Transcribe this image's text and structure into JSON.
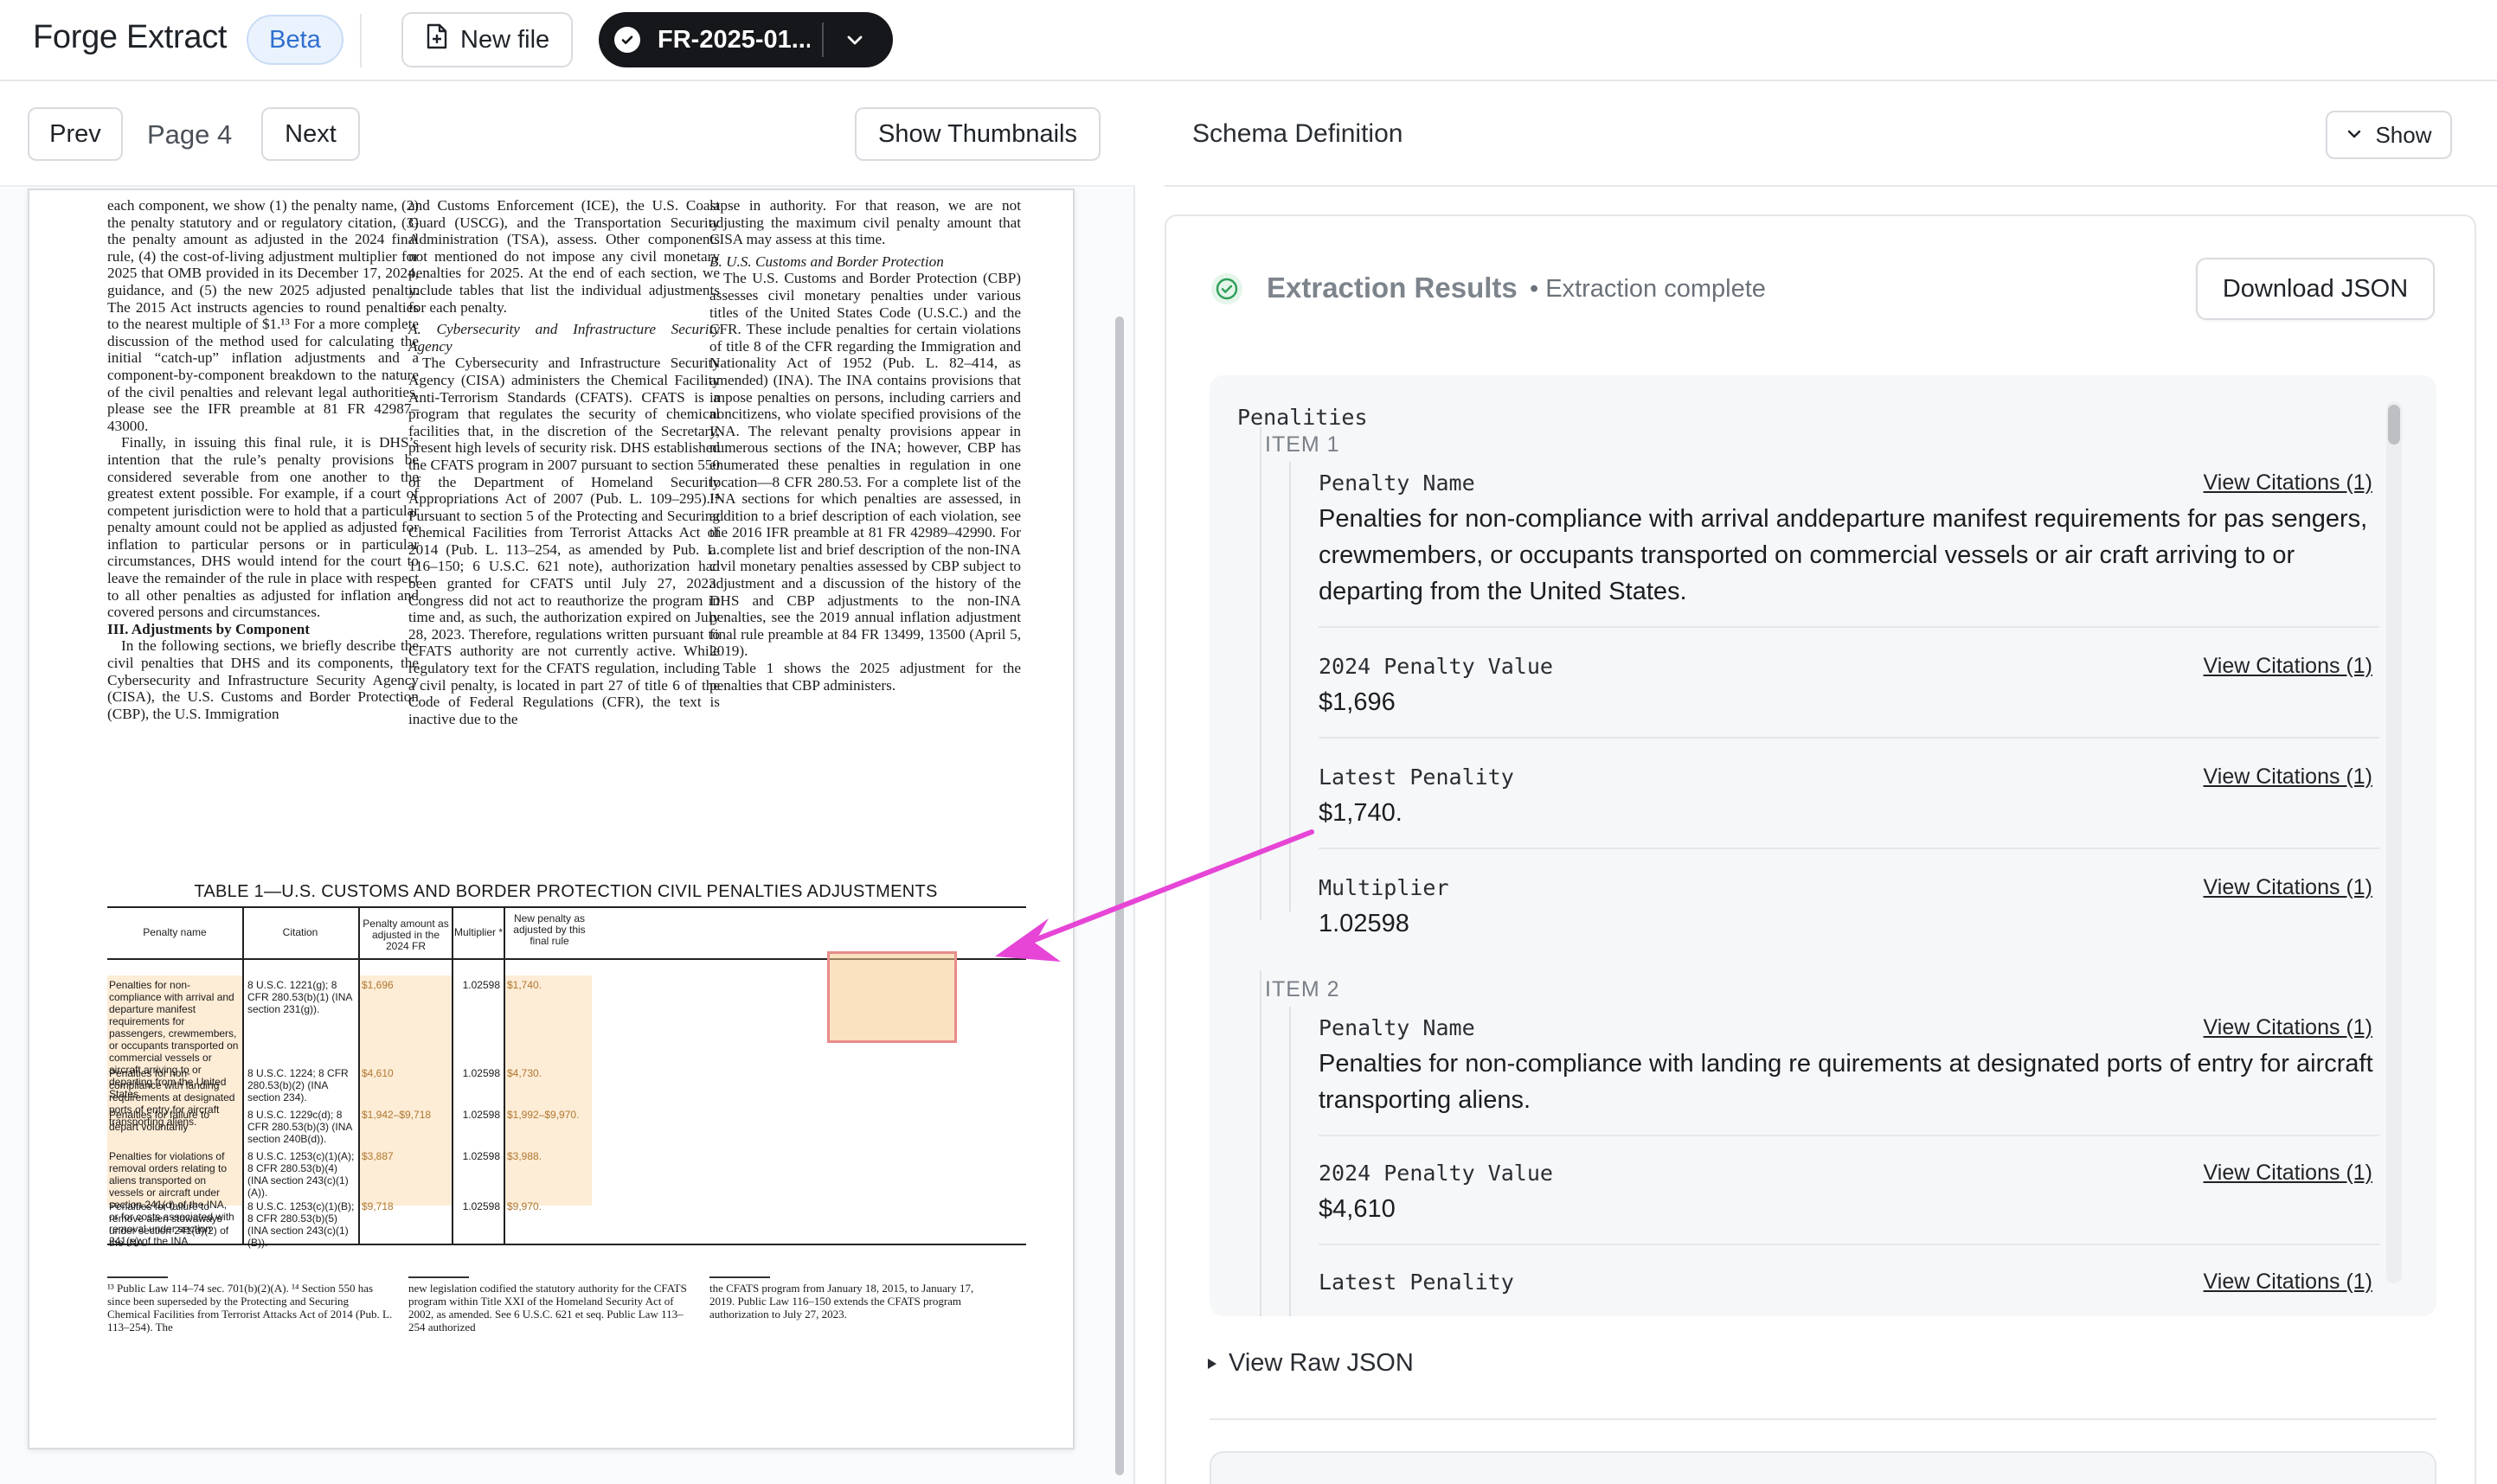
{
  "topbar": {
    "brand": "Forge Extract",
    "badge": "Beta",
    "new_file": "New file",
    "document": "FR-2025-01..."
  },
  "pager": {
    "prev": "Prev",
    "page": "Page 4",
    "next": "Next",
    "thumbnails": "Show Thumbnails"
  },
  "document": {
    "col1": [
      "each component, we show (1) the penalty name, (2) the penalty statutory and or regulatory citation, (3) the penalty amount as adjusted in the 2024 final rule, (4) the cost-of-living adjustment multiplier for 2025 that OMB provided in its December 17, 2024, guidance, and (5) the new 2025 adjusted penalty. The 2015 Act instructs agencies to round penalties to the nearest multiple of $1.¹³ For a more complete discussion of the method used for calculating the initial “catch-up” inflation adjustments and a component-by-component breakdown to the nature of the civil penalties and relevant legal authorities, please see the IFR preamble at 81 FR 42987–43000.",
      "Finally, in issuing this final rule, it is DHS’s intention that the rule’s penalty provisions be considered severable from one another to the greatest extent possible. For example, if a court of competent jurisdiction were to hold that a particular penalty amount could not be applied as adjusted for inflation to particular persons or in particular circumstances, DHS would intend for the court to leave the remainder of the rule in place with respect to all other penalties as adjusted for inflation and covered persons and circumstances.",
      "III. Adjustments by Component",
      "In the following sections, we briefly describe the civil penalties that DHS and its components, the Cybersecurity and Infrastructure Security Agency (CISA), the U.S. Customs and Border Protection (CBP), the U.S. Immigration"
    ],
    "col2": [
      "and Customs Enforcement (ICE), the U.S. Coast Guard (USCG), and the Transportation Security Administration (TSA), assess. Other components not mentioned do not impose any civil monetary penalties for 2025. At the end of each section, we include tables that list the individual adjustments for each penalty.",
      "A. Cybersecurity and Infrastructure Security Agency",
      "The Cybersecurity and Infrastructure Security Agency (CISA) administers the Chemical Facility Anti-Terrorism Standards (CFATS). CFATS is a program that regulates the security of chemical facilities that, in the discretion of the Secretary, present high levels of security risk. DHS established the CFATS program in 2007 pursuant to section 550 of the Department of Homeland Security Appropriations Act of 2007 (Pub. L. 109–295).¹⁴ Pursuant to section 5 of the Protecting and Securing Chemical Facilities from Terrorist Attacks Act of 2014 (Pub. L. 113–254, as amended by Pub. L. 116–150; 6 U.S.C. 621 note), authorization had been granted for CFATS until July 27, 2023. Congress did not act to reauthorize the program in time and, as such, the authorization expired on July 28, 2023. Therefore, regulations written pursuant to CFATS authority are not currently active. While regulatory text for the CFATS regulation, including a civil penalty, is located in part 27 of title 6 of the Code of Federal Regulations (CFR), the text is inactive due to the"
    ],
    "col3": [
      "lapse in authority. For that reason, we are not adjusting the maximum civil penalty amount that CISA may assess at this time.",
      "B. U.S. Customs and Border Protection",
      "The U.S. Customs and Border Protection (CBP) assesses civil monetary penalties under various titles of the United States Code (U.S.C.) and the CFR. These include penalties for certain violations of title 8 of the CFR regarding the Immigration and Nationality Act of 1952 (Pub. L. 82–414, as amended) (INA). The INA contains provisions that impose penalties on persons, including carriers and noncitizens, who violate specified provisions of the INA. The relevant penalty provisions appear in numerous sections of the INA; however, CBP has enumerated these penalties in regulation in one location—8 CFR 280.53. For a complete list of the INA sections for which penalties are assessed, in addition to a brief description of each violation, see the 2016 IFR preamble at 81 FR 42989–42990. For a complete list and brief description of the non-INA civil monetary penalties assessed by CBP subject to adjustment and a discussion of the history of the DHS and CBP adjustments to the non-INA penalties, see the 2019 annual inflation adjustment final rule preamble at 84 FR 13499, 13500 (April 5, 2019).",
      "Table 1 shows the 2025 adjustment for the penalties that CBP administers."
    ],
    "table_caption": "TABLE 1—U.S. CUSTOMS AND BORDER PROTECTION CIVIL PENALTIES ADJUSTMENTS",
    "table_headers": [
      "Penalty name",
      "Citation",
      "Penalty amount as adjusted in the 2024 FR",
      "Multiplier *",
      "New penalty as adjusted by this final rule"
    ],
    "table_rows": [
      {
        "name": "Penalties for non-compliance with arrival and departure manifest requirements for passengers, crewmembers, or occupants transported on commercial vessels or aircraft arriving to or departing from the United States.",
        "citation": "8 U.S.C. 1221(g); 8 CFR 280.53(b)(1) (INA section 231(g)).",
        "amount": "$1,696",
        "multiplier": "1.02598",
        "new": "$1,740."
      },
      {
        "name": "Penalties for non-compliance with landing requirements at designated ports of entry for aircraft transporting aliens.",
        "citation": "8 U.S.C. 1224; 8 CFR 280.53(b)(2) (INA section 234).",
        "amount": "$4,610",
        "multiplier": "1.02598",
        "new": "$4,730."
      },
      {
        "name": "Penalties for failure to depart voluntarily",
        "citation": "8 U.S.C. 1229c(d); 8 CFR 280.53(b)(3) (INA section 240B(d)).",
        "amount": "$1,942–$9,718",
        "multiplier": "1.02598",
        "new": "$1,992–$9,970."
      },
      {
        "name": "Penalties for violations of removal orders relating to aliens transported on vessels or aircraft under section 241(d) of the INA, or for costs associated with removal under section 241(e) of the INA.",
        "citation": "8 U.S.C. 1253(c)(1)(A); 8 CFR 280.53(b)(4) (INA section 243(c)(1)(A)).",
        "amount": "$3,887",
        "multiplier": "1.02598",
        "new": "$3,988."
      },
      {
        "name": "Penalties for failure to remove alien stowaways under section 241(d)(2) of the INA.",
        "citation": "8 U.S.C. 1253(c)(1)(B); 8 CFR 280.53(b)(5) (INA section 243(c)(1)(B)).",
        "amount": "$9,718",
        "multiplier": "1.02598",
        "new": "$9,970."
      }
    ],
    "footnotes": [
      "¹³ Public Law 114–74 sec. 701(b)(2)(A). ¹⁴ Section 550 has since been superseded by the Protecting and Securing Chemical Facilities from Terrorist Attacks Act of 2014 (Pub. L. 113–254). The",
      "new legislation codified the statutory authority for the CFATS program within Title XXI of the Homeland Security Act of 2002, as amended. See 6 U.S.C. 621 et seq. Public Law 113–254 authorized",
      "the CFATS program from January 18, 2015, to January 17, 2019. Public Law 116–150 extends the CFATS program authorization to July 27, 2023."
    ]
  },
  "schema": {
    "title": "Schema Definition",
    "show": "Show"
  },
  "results": {
    "title": "Extraction Results",
    "status": "• Extraction complete",
    "download": "Download JSON",
    "root_key": "Penalities",
    "cite_label": "View Citations (1)",
    "items": [
      {
        "label": "ITEM 1",
        "fields": [
          {
            "key": "Penalty Name",
            "value": "Penalties for non-compliance with arrival anddeparture manifest requirements for pas sengers, crewmembers, or occupants transported on commercial vessels or air craft arriving to or departing from the United States."
          },
          {
            "key": "2024 Penalty Value",
            "value": "$1,696"
          },
          {
            "key": "Latest Penality",
            "value": "$1,740."
          },
          {
            "key": "Multiplier",
            "value": "1.02598"
          }
        ]
      },
      {
        "label": "ITEM 2",
        "fields": [
          {
            "key": "Penalty Name",
            "value": "Penalties for non-compliance with landing re quirements at designated ports of entry for aircraft transporting aliens."
          },
          {
            "key": "2024 Penalty Value",
            "value": "$4,610"
          },
          {
            "key": "Latest Penality",
            "value": ""
          }
        ]
      }
    ],
    "raw_json": "View Raw JSON"
  },
  "colors": {
    "accent_dark": "#15171a",
    "badge_blue": "#2f6fcf",
    "highlight": "#fdecd6",
    "arrow": "#e645d6",
    "success": "#2f9e57"
  }
}
